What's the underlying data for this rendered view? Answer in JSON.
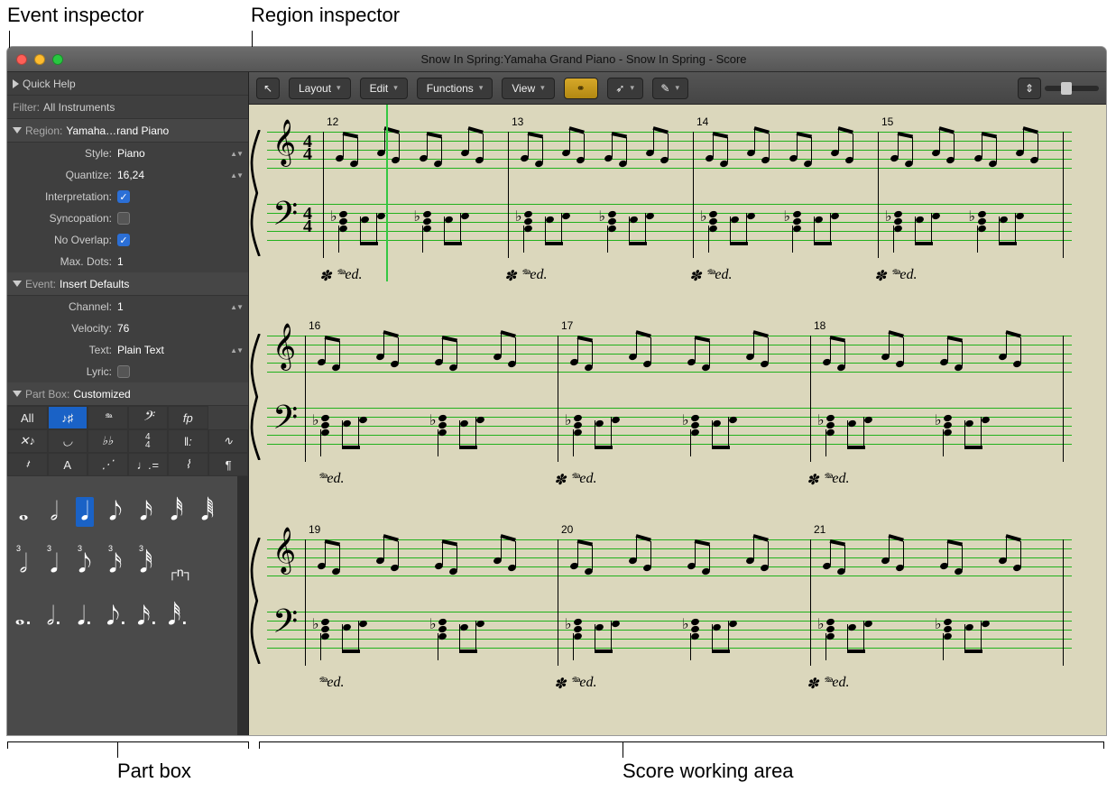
{
  "annotations": {
    "event_inspector": "Event inspector",
    "region_inspector": "Region inspector",
    "part_box": "Part box",
    "score_area": "Score working area"
  },
  "window": {
    "title": "Snow In Spring:Yamaha Grand Piano - Snow In Spring - Score"
  },
  "sidebar": {
    "quick_help": "Quick Help",
    "filter_label": "Filter:",
    "filter_value": "All Instruments",
    "region_header": "Region:",
    "region_value": "Yamaha…rand Piano",
    "style_label": "Style:",
    "style_value": "Piano",
    "quantize_label": "Quantize:",
    "quantize_value": "16,24",
    "interpretation_label": "Interpretation:",
    "syncopation_label": "Syncopation:",
    "nooverlap_label": "No Overlap:",
    "maxdots_label": "Max. Dots:",
    "maxdots_value": "1",
    "event_header": "Event:",
    "event_value": "Insert Defaults",
    "channel_label": "Channel:",
    "channel_value": "1",
    "velocity_label": "Velocity:",
    "velocity_value": "76",
    "text_label": "Text:",
    "text_value": "Plain Text",
    "lyric_label": "Lyric:",
    "partbox_header": "Part Box:",
    "partbox_value": "Customized",
    "tab_all": "All"
  },
  "toolbar": {
    "layout": "Layout",
    "edit": "Edit",
    "functions": "Functions",
    "view": "View"
  },
  "score": {
    "timesig_top": "4",
    "timesig_bot": "4",
    "bars_sys1": [
      "12",
      "13",
      "14",
      "15"
    ],
    "bars_sys2": [
      "16",
      "17",
      "18"
    ],
    "bars_sys3": [
      "19",
      "20",
      "21"
    ],
    "ped": "𝆮𝆯"
  }
}
